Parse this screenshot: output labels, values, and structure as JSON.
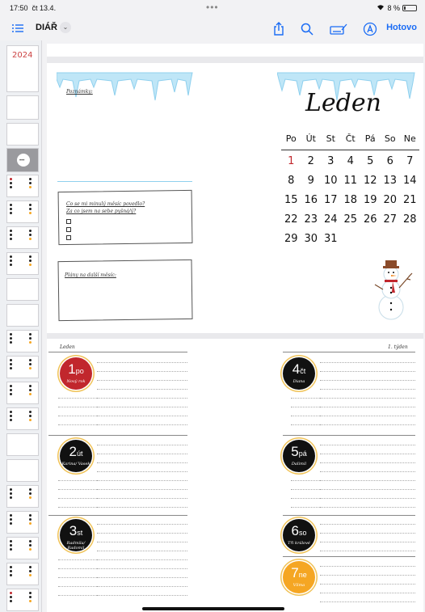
{
  "status": {
    "time": "17:50",
    "date": "čt 13.4.",
    "battery": "8 %"
  },
  "toolbar": {
    "title": "DIÁŘ",
    "done_label": "Hotovo"
  },
  "left_page": {
    "notes_label": "Poznámky:",
    "question_line1": "Co se mi minulý měsíc povedlo?",
    "question_line2": "Za co jsem na sebe pyšná/ý?",
    "plans_label": "Plány na další měsíc:"
  },
  "calendar": {
    "month": "Leden",
    "weekdays": [
      "Po",
      "Út",
      "St",
      "Čt",
      "Pá",
      "So",
      "Ne"
    ],
    "weeks": [
      [
        "1",
        "2",
        "3",
        "4",
        "5",
        "6",
        "7"
      ],
      [
        "8",
        "9",
        "10",
        "11",
        "12",
        "13",
        "14"
      ],
      [
        "15",
        "16",
        "17",
        "18",
        "19",
        "20",
        "21"
      ],
      [
        "22",
        "23",
        "24",
        "25",
        "26",
        "27",
        "28"
      ],
      [
        "29",
        "30",
        "31",
        "",
        "",
        "",
        ""
      ]
    ],
    "highlight_color": "#c1272d"
  },
  "week": {
    "month_label": "Leden",
    "week_label": "1. týden",
    "days": [
      {
        "num": "1",
        "abbr": "po",
        "name": "Nový rok",
        "color": "#c1272d"
      },
      {
        "num": "2",
        "abbr": "út",
        "name": "Karina/ Vasek",
        "color": "#111111"
      },
      {
        "num": "3",
        "abbr": "st",
        "name": "Radmila/ Radomil",
        "color": "#111111"
      },
      {
        "num": "4",
        "abbr": "čt",
        "name": "Diana",
        "color": "#111111"
      },
      {
        "num": "5",
        "abbr": "pá",
        "name": "Dalimil",
        "color": "#111111"
      },
      {
        "num": "6",
        "abbr": "so",
        "name": "Tři králové",
        "color": "#111111"
      },
      {
        "num": "7",
        "abbr": "ne",
        "name": "Vilma",
        "color": "#f5a623"
      }
    ]
  }
}
